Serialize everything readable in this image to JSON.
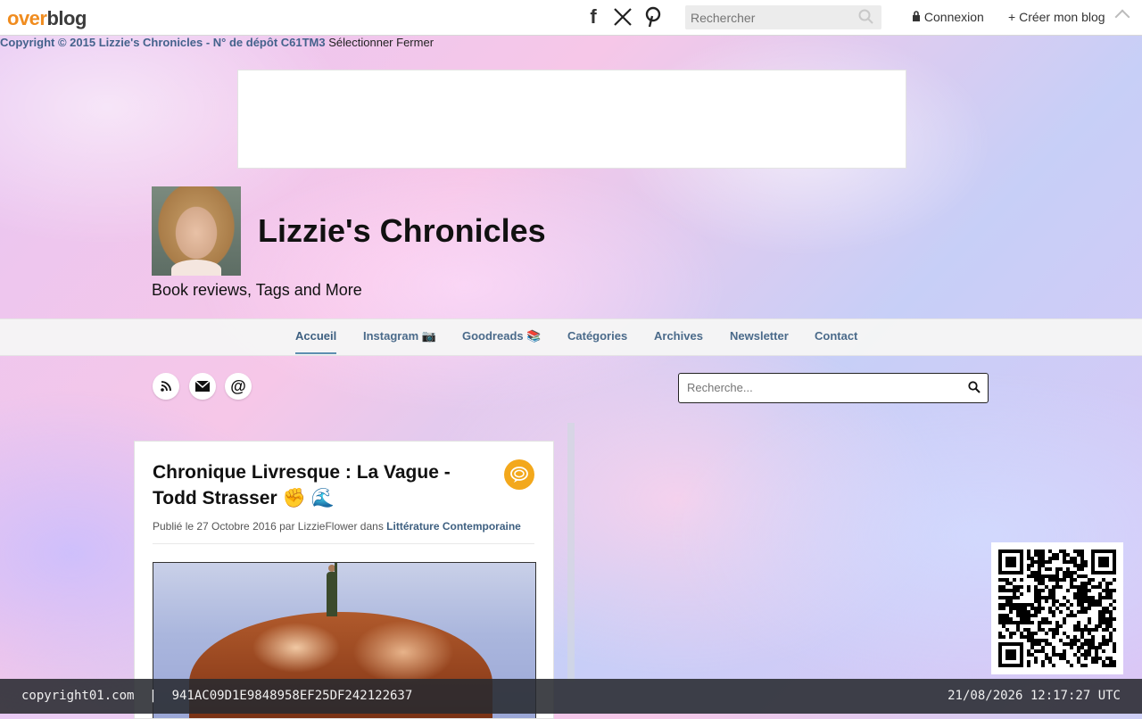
{
  "topbar": {
    "logo_part1": "over",
    "logo_part2": "blog",
    "social_icons": [
      "facebook-icon",
      "x-icon",
      "pinterest-icon"
    ],
    "search_placeholder": "Rechercher",
    "login_label": "Connexion",
    "create_blog_label": "Créer mon blog"
  },
  "copyright_bar": {
    "text": "Copyright © 2015 Lizzie's Chronicles - N° de dépôt C61TM3",
    "select_label": "Sélectionner",
    "close_label": "Fermer"
  },
  "header": {
    "site_title": "Lizzie's Chronicles",
    "subtitle": "Book reviews, Tags and More"
  },
  "nav": {
    "items": [
      {
        "label": "Accueil",
        "active": true
      },
      {
        "label": "Instagram 📷",
        "active": false
      },
      {
        "label": "Goodreads 📚",
        "active": false
      },
      {
        "label": "Catégories",
        "active": false
      },
      {
        "label": "Archives",
        "active": false
      },
      {
        "label": "Newsletter",
        "active": false
      },
      {
        "label": "Contact",
        "active": false
      }
    ]
  },
  "follow_icons": [
    "rss-icon",
    "mail-icon",
    "at-icon"
  ],
  "sidebar": {
    "search_placeholder": "Recherche..."
  },
  "post": {
    "title": "Chronique Livresque : La Vague - Todd Strasser ✊ 🌊",
    "meta_prefix": "Publié le 27 Octobre 2016 par LizzieFlower dans",
    "category": "Littérature Contemporaine",
    "badge_icon": "speech-bubble-icon"
  },
  "footer": {
    "left": "copyright01.com  |  941AC09D1E9848958EF25DF242122637",
    "right": "21/08/2026 12:17:27 UTC"
  },
  "colors": {
    "logo_orange": "#f08c1f",
    "nav_link": "#4a6a8a",
    "badge_orange": "#f3a81c"
  }
}
